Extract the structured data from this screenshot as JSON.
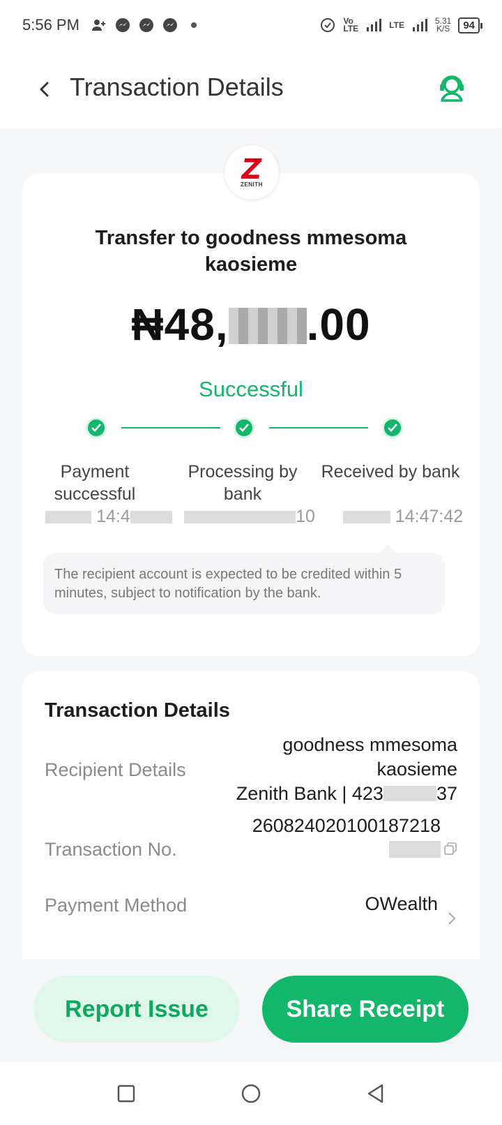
{
  "status_bar": {
    "time": "5:56 PM",
    "network_speed": "5.31",
    "network_speed_unit": "K/S",
    "battery": "94"
  },
  "header": {
    "title": "Transaction Details"
  },
  "summary": {
    "bank_logo_text": "ZENITH",
    "title": "Transfer to goodness mmesoma kaosieme",
    "amount_prefix": "₦48,",
    "amount_suffix": ".00",
    "status": "Successful",
    "steps": [
      {
        "label": "Payment successful",
        "time": "14:4"
      },
      {
        "label": "Processing by bank",
        "time": "10"
      },
      {
        "label": "Received by bank",
        "time": "14:47:42"
      }
    ],
    "note": "The recipient account is expected to be credited within 5 minutes, subject to notification by the bank."
  },
  "details": {
    "title": "Transaction Details",
    "recipient_label": "Recipient Details",
    "recipient_name": "goodness mmesoma kaosieme",
    "recipient_bank_prefix": "Zenith Bank | 423",
    "recipient_bank_suffix": "37",
    "txn_label": "Transaction No.",
    "txn_number": "260824020100187218",
    "method_label": "Payment Method",
    "method_value": "OWealth"
  },
  "actions": {
    "report_label": "Report Issue",
    "share_label": "Share Receipt"
  },
  "colors": {
    "accent": "#12b76a",
    "accent_light": "#dff6ea",
    "bank_red": "#e0001b"
  }
}
